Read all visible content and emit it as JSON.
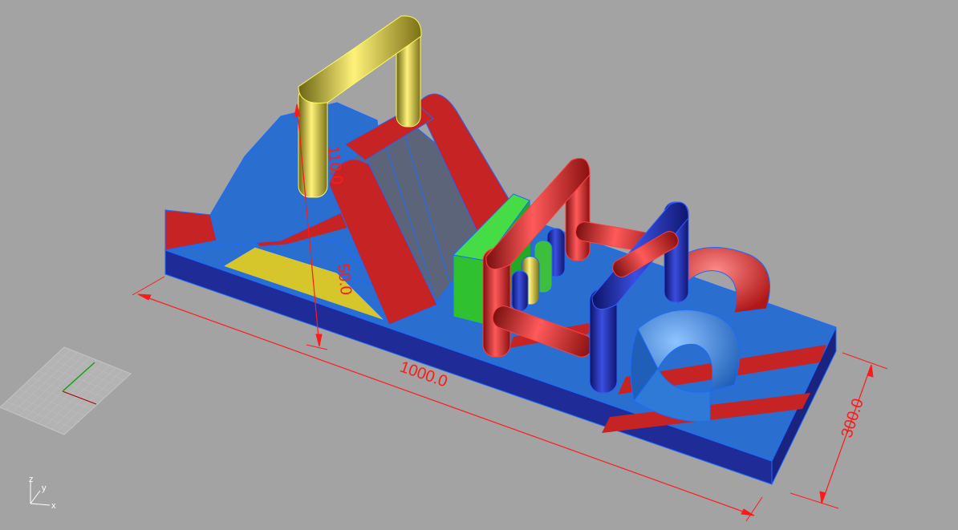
{
  "viewport": {
    "background": "#a3a3a3",
    "dimension_color": "#ff1a1a",
    "dimensions": {
      "length": "1000.0",
      "width": "300.0",
      "height": "110.0",
      "sub_height": "50.0"
    },
    "axes": {
      "x": "x",
      "y": "y",
      "z": "z"
    },
    "model_colors": {
      "blue": "#2a6fcf",
      "dark_blue": "#1c2a9e",
      "red": "#c62424",
      "yellow": "#d6c62c",
      "green": "#33c233"
    },
    "icons": [
      "construction-plane-grid-icon",
      "world-axes-icon"
    ]
  }
}
